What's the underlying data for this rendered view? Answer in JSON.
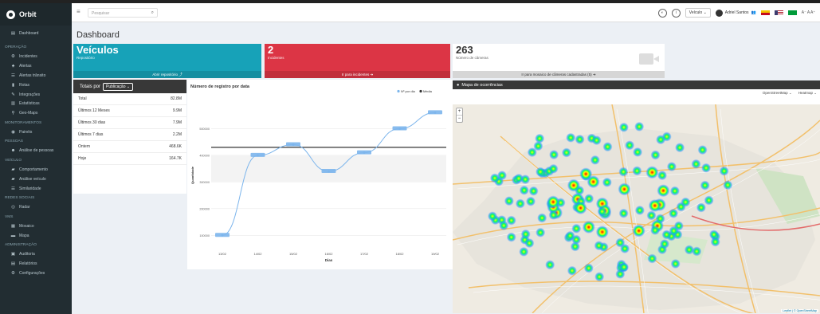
{
  "app": {
    "name": "Orbit"
  },
  "sidebar": {
    "dashboard": "Dashboard",
    "groups": [
      {
        "header": "OPERAÇÃO",
        "items": [
          {
            "label": "Incidentes",
            "icon": "gear-icon"
          },
          {
            "label": "Alertas",
            "icon": "bell-icon"
          },
          {
            "label": "Alertas trânsito",
            "icon": "traffic-icon"
          },
          {
            "label": "Rotas",
            "icon": "route-icon"
          },
          {
            "label": "Integrações",
            "icon": "link-icon"
          },
          {
            "label": "Estatísticas",
            "icon": "chart-icon"
          },
          {
            "label": "Geo-Maps",
            "icon": "pin-icon"
          }
        ]
      },
      {
        "header": "MONITORAMENTOS",
        "items": [
          {
            "label": "Painéis",
            "icon": "eye-icon"
          }
        ]
      },
      {
        "header": "PESSOAS",
        "items": [
          {
            "label": "Análise de pessoas",
            "icon": "people-icon"
          }
        ]
      },
      {
        "header": "VEÍCULO",
        "items": [
          {
            "label": "Comportamento",
            "icon": "car-icon"
          },
          {
            "label": "Análise veículo",
            "icon": "car-icon"
          },
          {
            "label": "Similaridade",
            "icon": "list-icon"
          }
        ]
      },
      {
        "header": "REDES SOCIAIS",
        "items": [
          {
            "label": "Radar",
            "icon": "radar-icon"
          }
        ]
      },
      {
        "header": "VMS",
        "items": [
          {
            "label": "Mosaico",
            "icon": "grid-icon"
          },
          {
            "label": "Mapa",
            "icon": "map-icon"
          }
        ]
      },
      {
        "header": "ADMINISTRAÇÃO",
        "items": [
          {
            "label": "Auditoria",
            "icon": "audit-icon"
          },
          {
            "label": "Relatórios",
            "icon": "report-icon"
          },
          {
            "label": "Configurações",
            "icon": "config-icon"
          }
        ]
      }
    ]
  },
  "topbar": {
    "search_placeholder": "Pesquisar",
    "vehicle_select": "Veículo",
    "user_name": "Adriel Santos",
    "font_controls": "A⁻ A A⁺"
  },
  "page": {
    "title": "Dashboard"
  },
  "cards": {
    "vehicles": {
      "title": "Veículos",
      "subtitle": "Repositório",
      "footer": "Abrir repositório ⤴"
    },
    "incidents": {
      "value": "2",
      "subtitle": "Incidentes",
      "footer": "Ir para incidentes ➔"
    },
    "cameras": {
      "value": "263",
      "subtitle": "Número de câmeras",
      "footer": "Ir para mosaico de câmeras cadastradas (5) ➔"
    }
  },
  "totals": {
    "header_prefix": "Totais por",
    "header_select": "Publicação ⌄",
    "rows": [
      {
        "label": "Total",
        "value": "82.8M"
      },
      {
        "label": "Últimos 12 Meses",
        "value": "9.9M"
      },
      {
        "label": "Últimos 30 dias",
        "value": "7.9M"
      },
      {
        "label": "Últimos 7 dias",
        "value": "2.2M"
      },
      {
        "label": "Ontem",
        "value": "468.6K"
      },
      {
        "label": "Hoje",
        "value": "164.7K"
      }
    ]
  },
  "chart_data": {
    "type": "line",
    "title": "Número de registro por data",
    "xlabel": "Dias",
    "ylabel": "Quantidade",
    "categories": [
      "13/02",
      "14/02",
      "15/02",
      "16/02",
      "17/02",
      "18/02",
      "19/02"
    ],
    "series": [
      {
        "name": "Nº por dia",
        "values": [
          100000,
          400000,
          440000,
          340000,
          410000,
          500000,
          560000
        ],
        "color": "#7cb5ec"
      },
      {
        "name": "Média",
        "values": [
          430000,
          430000,
          430000,
          430000,
          430000,
          430000,
          430000
        ],
        "color": "#333333"
      }
    ],
    "yticks": [
      "100000",
      "200000",
      "300000",
      "400000",
      "500000"
    ],
    "ylim": [
      50000,
      600000
    ],
    "grid": true,
    "legend_position": "top-right"
  },
  "map": {
    "title": "Mapa de ocorrências",
    "layer_base": "OpenStreetMap",
    "layer_overlay": "Heatmap",
    "attribution": "Leaflet | © OpenStreetMap"
  }
}
